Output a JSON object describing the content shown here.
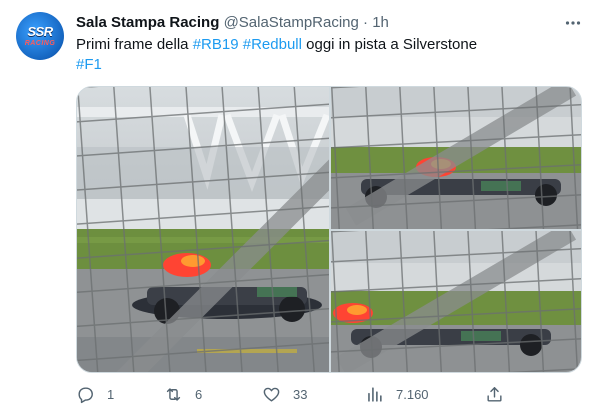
{
  "tweet": {
    "avatar_text": "SSR",
    "avatar_subtext": "RACING",
    "author_name": "Sala Stampa Racing",
    "handle": "@SalaStampRacing",
    "separator": "·",
    "time": "1h",
    "text": {
      "line1_prefix": "Primi frame della ",
      "tag_rb19": "#RB19",
      "space": " ",
      "tag_redbull": "#Redbull",
      "line1_suffix": " oggi in pista a Silverstone",
      "tag_f1": "#F1"
    },
    "media": {
      "images": [
        "photo-1",
        "photo-2",
        "photo-3"
      ]
    },
    "actions": {
      "reply_count": "1",
      "retweet_count": "6",
      "like_count": "33",
      "views_count": "7.160"
    }
  },
  "colors": {
    "link": "#1d9bf0",
    "secondary_text": "#536471",
    "primary_text": "#0f1419",
    "border": "#cfd9de"
  },
  "icons": {
    "more": "more-dots-icon",
    "reply": "reply-icon",
    "retweet": "retweet-icon",
    "like": "heart-icon",
    "views": "views-bar-chart-icon",
    "share": "share-icon"
  }
}
